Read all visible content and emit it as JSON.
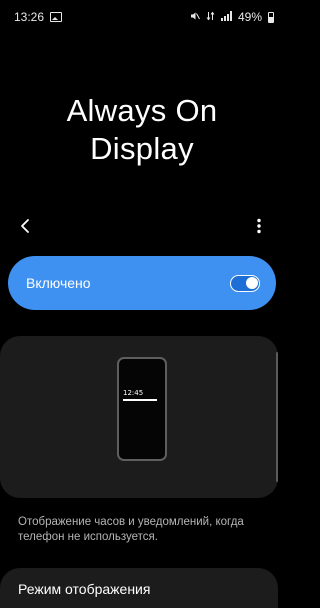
{
  "status_bar": {
    "time": "13:26",
    "battery": "49%",
    "icons": [
      "gallery-icon",
      "mute-icon",
      "data-icon",
      "signal-icon",
      "battery-icon"
    ]
  },
  "header": {
    "title_line1": "Always On",
    "title_line2": "Display"
  },
  "toolbar": {
    "back_icon": "chevron-left-icon",
    "more_icon": "more-vertical-icon"
  },
  "master_switch": {
    "label": "Включено",
    "state": "on",
    "color": "#3e91f0"
  },
  "preview": {
    "clock_time": "12:45"
  },
  "description": "Отображение часов и уведомлений, когда телефон не используется.",
  "settings": {
    "items": [
      {
        "label": "Режим отображения"
      }
    ]
  }
}
